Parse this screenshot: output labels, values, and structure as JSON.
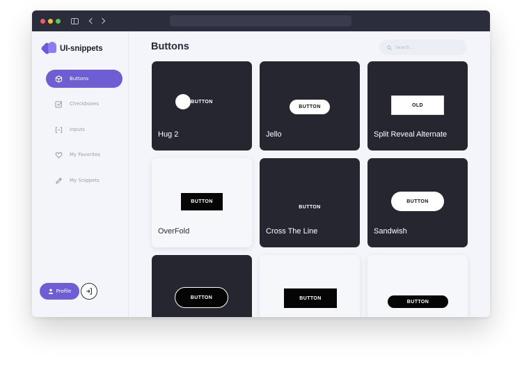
{
  "app": {
    "logo_text": "UI-snippets"
  },
  "sidebar": {
    "items": [
      {
        "label": "Buttons",
        "icon": "cube-icon",
        "active": true
      },
      {
        "label": "Checkboxes",
        "icon": "checkbox-icon",
        "active": false
      },
      {
        "label": "Inputs",
        "icon": "input-brackets-icon",
        "active": false
      },
      {
        "label": "My Favorites",
        "icon": "heart-icon",
        "active": false
      },
      {
        "label": "My Snippets",
        "icon": "pencil-icon",
        "active": false
      }
    ],
    "profile_label": "Profile"
  },
  "main": {
    "title": "Buttons",
    "search_placeholder": "Search..."
  },
  "cards": [
    {
      "title": "Hug 2",
      "theme": "dark",
      "button_label": "BUTTON"
    },
    {
      "title": "Jello",
      "theme": "dark",
      "button_label": "BUTTON"
    },
    {
      "title": "Split Reveal Alternate",
      "theme": "dark",
      "button_label": "OLD"
    },
    {
      "title": "OverFold",
      "theme": "light",
      "button_label": "BUTTON"
    },
    {
      "title": "Cross The Line",
      "theme": "dark",
      "button_label": "BUTTON"
    },
    {
      "title": "Sandwish",
      "theme": "dark",
      "button_label": "BUTTON"
    },
    {
      "title": "",
      "theme": "dark",
      "button_label": "BUTTON"
    },
    {
      "title": "",
      "theme": "light",
      "button_label": "BUTTON"
    },
    {
      "title": "",
      "theme": "light",
      "button_label": "BUTTON"
    }
  ],
  "colors": {
    "accent": "#6d5fd3",
    "card_dark": "#25262f",
    "titlebar": "#2b2d3d",
    "background": "#f4f5fb"
  }
}
